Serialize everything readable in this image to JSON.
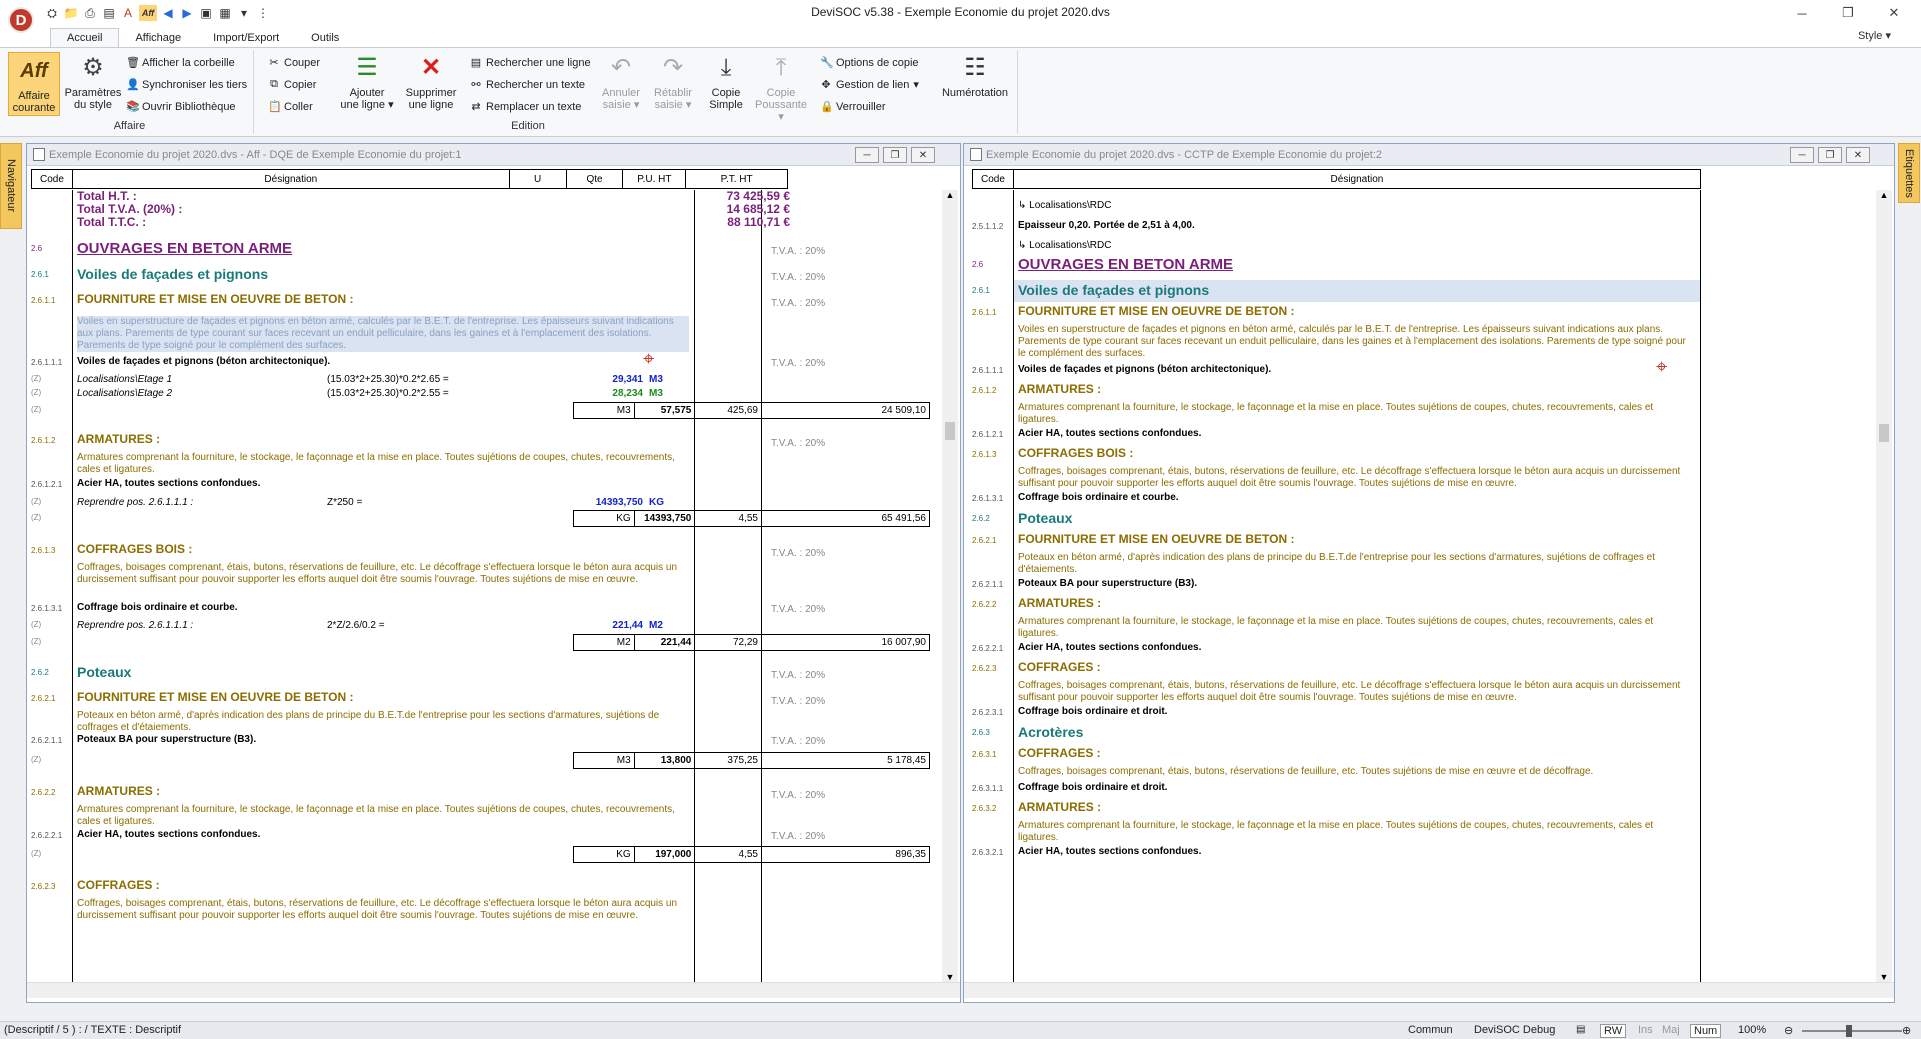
{
  "window": {
    "title": "DeviSOC v5.38 - Exemple Economie du projet 2020.dvs",
    "logo": "D",
    "style_menu": "Style",
    "qa_label": "Aff"
  },
  "tabs": [
    "Accueil",
    "Affichage",
    "Import/Export",
    "Outils"
  ],
  "ribbon": {
    "affaire": {
      "label": "Affaire",
      "aff_big": "Aff",
      "aff_line1": "Affaire",
      "aff_line2": "courante",
      "param_line1": "Paramètres",
      "param_line2": "du style",
      "corbeille": "Afficher la corbeille",
      "sync": "Synchroniser les tiers",
      "biblio": "Ouvrir Bibliothèque"
    },
    "edition": {
      "label": "Edition",
      "couper": "Couper",
      "copier": "Copier",
      "coller": "Coller",
      "ajouter1": "Ajouter",
      "ajouter2": "une ligne",
      "suppr1": "Supprimer",
      "suppr2": "une ligne",
      "rech_ligne": "Rechercher une ligne",
      "rech_texte": "Rechercher un texte",
      "remp_texte": "Remplacer un texte",
      "annuler1": "Annuler",
      "annuler2": "saisie",
      "retablir1": "Rétablir",
      "retablir2": "saisie",
      "copie1": "Copie",
      "copie2": "Simple",
      "copiep1": "Copie",
      "copiep2": "Poussante",
      "options": "Options de copie",
      "gestion": "Gestion de lien",
      "verrou": "Verrouiller",
      "numero": "Numérotation"
    }
  },
  "side": {
    "left": "Navigateur",
    "right": "Etiquettes"
  },
  "left_pane": {
    "title": "Exemple Economie du projet 2020.dvs - Aff - DQE de Exemple Economie du projet:1",
    "headers": [
      "Code",
      "Désignation",
      "U",
      "Qte",
      "P.U. HT",
      "P.T. HT"
    ],
    "totals": {
      "ht_label": "Total H.T. :",
      "ht_value": "73 425,59 €",
      "tva_label": "Total T.V.A. (20%) :",
      "tva_value": "14 685,12 €",
      "ttc_label": "Total T.T.C. :",
      "ttc_value": "88 110,71 €"
    },
    "tva": "T.V.A. : 20%",
    "rows": [
      {
        "code": "2.6",
        "text": "OUVRAGES EN BETON ARME"
      },
      {
        "code": "2.6.1",
        "text": "Voiles de façades et pignons"
      },
      {
        "code": "2.6.1.1",
        "text": "FOURNITURE ET MISE EN OEUVRE DE BETON :"
      },
      {
        "text": "Voiles en superstructure de façades et pignons en béton armé, calculés par le B.E.T. de l'entreprise. Les épaisseurs suivant indications aux plans. Parements de type courant sur faces recevant un enduit pelliculaire, dans les gaines et à l'emplacement des isolations. Parements de type soigné pour le complément des surfaces."
      },
      {
        "code": "2.6.1.1.1",
        "text": "Voiles de façades et pignons (béton architectonique)."
      },
      {
        "code": "(Z)",
        "text": "Localisations\\Etage 1",
        "formula": "(15.03*2+25.30)*0.2*2.65 =",
        "qty": "29,341",
        "unit": "M3"
      },
      {
        "code": "(Z)",
        "text": "Localisations\\Etage 2",
        "formula": "(15.03*2+25.30)*0.2*2.55 =",
        "qty": "28,234",
        "unit": "M3"
      },
      {
        "code": "(Z)",
        "u": "M3",
        "qte": "57,575",
        "pu": "425,69",
        "pt": "24 509,10"
      },
      {
        "code": "2.6.1.2",
        "text": "ARMATURES :"
      },
      {
        "text": "Armatures comprenant la fourniture, le stockage, le façonnage et la mise en place. Toutes sujétions de coupes, chutes, recouvrements, cales et ligatures."
      },
      {
        "code": "2.6.1.2.1",
        "text": "Acier HA, toutes sections confondues."
      },
      {
        "code": "(Z)",
        "text": "Reprendre pos. 2.6.1.1.1 :",
        "formula": "Z*250 =",
        "qty": "14393,750",
        "unit": "KG"
      },
      {
        "code": "(Z)",
        "u": "KG",
        "qte": "14393,750",
        "pu": "4,55",
        "pt": "65 491,56"
      },
      {
        "code": "2.6.1.3",
        "text": "COFFRAGES BOIS :"
      },
      {
        "text": "Coffrages, boisages comprenant, étais, butons, réservations de feuillure, etc. Le décoffrage s'effectuera lorsque le béton aura acquis un durcissement suffisant pour pouvoir supporter les efforts auquel doit être soumis l'ouvrage. Toutes sujétions de mise en œuvre."
      },
      {
        "code": "2.6.1.3.1",
        "text": "Coffrage bois ordinaire et courbe."
      },
      {
        "code": "(Z)",
        "text": "Reprendre pos. 2.6.1.1.1 :",
        "formula": "2*Z/2.6/0.2 =",
        "qty": "221,44",
        "unit": "M2"
      },
      {
        "code": "(Z)",
        "u": "M2",
        "qte": "221,44",
        "pu": "72,29",
        "pt": "16 007,90"
      },
      {
        "code": "2.6.2",
        "text": "Poteaux"
      },
      {
        "code": "2.6.2.1",
        "text": "FOURNITURE ET MISE EN OEUVRE DE BETON :"
      },
      {
        "text": "Poteaux en béton armé, d'après indication des plans de principe du B.E.T.de l'entreprise pour les sections d'armatures, sujétions de coffrages et d'étaiements."
      },
      {
        "code": "2.6.2.1.1",
        "text": "Poteaux BA pour superstructure (B3)."
      },
      {
        "code": "(Z)",
        "u": "M3",
        "qte": "13,800",
        "pu": "375,25",
        "pt": "5 178,45"
      },
      {
        "code": "2.6.2.2",
        "text": "ARMATURES :"
      },
      {
        "text": "Armatures comprenant la fourniture, le stockage, le façonnage et la mise en place. Toutes sujétions de coupes, chutes, recouvrements, cales et ligatures."
      },
      {
        "code": "2.6.2.2.1",
        "text": "Acier HA, toutes sections confondues."
      },
      {
        "code": "(Z)",
        "u": "KG",
        "qte": "197,000",
        "pu": "4,55",
        "pt": "896,35"
      },
      {
        "code": "2.6.2.3",
        "text": "COFFRAGES :"
      },
      {
        "text": "Coffrages, boisages comprenant, étais, butons, réservations de feuillure, etc. Le décoffrage s'effectuera lorsque le béton aura acquis un durcissement suffisant pour pouvoir supporter les efforts auquel doit être soumis l'ouvrage. Toutes sujétions de mise en œuvre."
      }
    ]
  },
  "right_pane": {
    "title": "Exemple Economie du projet 2020.dvs - CCTP de Exemple Economie du projet:2",
    "headers": [
      "Code",
      "Désignation"
    ],
    "rows": [
      {
        "text": "Localisations\\RDC"
      },
      {
        "code": "2.5.1.1.2",
        "text": "Epaisseur 0,20. Portée de 2,51 à 4,00."
      },
      {
        "text": "Localisations\\RDC"
      },
      {
        "code": "2.6",
        "text": "OUVRAGES EN BETON ARME"
      },
      {
        "code": "2.6.1",
        "text": "Voiles de façades et pignons"
      },
      {
        "code": "2.6.1.1",
        "text": "FOURNITURE ET MISE EN OEUVRE DE BETON :"
      },
      {
        "text": "Voiles en superstructure de façades et pignons en béton armé, calculés par le B.E.T. de l'entreprise. Les épaisseurs suivant indications aux plans. Parements de type courant sur faces recevant un enduit pelliculaire, dans les gaines et à l'emplacement des isolations. Parements de type soigné pour le complément des surfaces."
      },
      {
        "code": "2.6.1.1.1",
        "text": "Voiles de façades et pignons (béton architectonique)."
      },
      {
        "code": "2.6.1.2",
        "text": "ARMATURES :"
      },
      {
        "text": "Armatures comprenant la fourniture, le stockage, le façonnage et la mise en place. Toutes sujétions de coupes, chutes, recouvrements, cales et ligatures."
      },
      {
        "code": "2.6.1.2.1",
        "text": "Acier HA, toutes sections confondues."
      },
      {
        "code": "2.6.1.3",
        "text": "COFFRAGES BOIS :"
      },
      {
        "text": "Coffrages, boisages comprenant, étais, butons, réservations de feuillure, etc. Le décoffrage s'effectuera lorsque le béton aura acquis un durcissement suffisant pour pouvoir supporter les efforts auquel doit être soumis l'ouvrage. Toutes sujétions de mise en œuvre."
      },
      {
        "code": "2.6.1.3.1",
        "text": "Coffrage bois ordinaire et courbe."
      },
      {
        "code": "2.6.2",
        "text": "Poteaux"
      },
      {
        "code": "2.6.2.1",
        "text": "FOURNITURE ET MISE EN OEUVRE DE BETON :"
      },
      {
        "text": "Poteaux en béton armé, d'après indication des plans de principe du B.E.T.de l'entreprise pour les sections d'armatures, sujétions de coffrages et d'étaiements."
      },
      {
        "code": "2.6.2.1.1",
        "text": "Poteaux BA pour superstructure (B3)."
      },
      {
        "code": "2.6.2.2",
        "text": "ARMATURES :"
      },
      {
        "text": "Armatures comprenant la fourniture, le stockage, le façonnage et la mise en place. Toutes sujétions de coupes, chutes, recouvrements, cales et ligatures."
      },
      {
        "code": "2.6.2.2.1",
        "text": "Acier HA, toutes sections confondues."
      },
      {
        "code": "2.6.2.3",
        "text": "COFFRAGES :"
      },
      {
        "text": "Coffrages, boisages comprenant, étais, butons, réservations de feuillure, etc. Le décoffrage s'effectuera lorsque le béton aura acquis un durcissement suffisant pour pouvoir supporter les efforts auquel doit être soumis l'ouvrage. Toutes sujétions de mise en œuvre."
      },
      {
        "code": "2.6.2.3.1",
        "text": "Coffrage bois ordinaire et droit."
      },
      {
        "code": "2.6.3",
        "text": "Acrotères"
      },
      {
        "code": "2.6.3.1",
        "text": "COFFRAGES :"
      },
      {
        "text": "Coffrages, boisages comprenant, étais, butons, réservations de feuillure, etc. Toutes sujétions de mise en œuvre et de décoffrage."
      },
      {
        "code": "2.6.3.1.1",
        "text": "Coffrage bois ordinaire et droit."
      },
      {
        "code": "2.6.3.2",
        "text": "ARMATURES :"
      },
      {
        "text": "Armatures comprenant la fourniture, le stockage, le façonnage et la mise en place.  Toutes sujétions de coupes, chutes, recouvrements, cales et ligatures."
      },
      {
        "code": "2.6.3.2.1",
        "text": "Acier HA, toutes sections confondues."
      }
    ]
  },
  "status": {
    "left": "(Descriptif / 5 ) :  / TEXTE : Descriptif",
    "commun": "Commun",
    "debug": "DeviSOC Debug",
    "rw": "RW",
    "ins": "Ins",
    "maj": "Maj",
    "num": "Num",
    "zoom": "100%"
  },
  "colors": {
    "purple": "#7a1f7a",
    "teal": "#1a7a7a",
    "olive": "#8c6d00",
    "blue": "#1024c8",
    "green": "#1d8a1d",
    "ribbon_selected": "#fcd57a"
  }
}
